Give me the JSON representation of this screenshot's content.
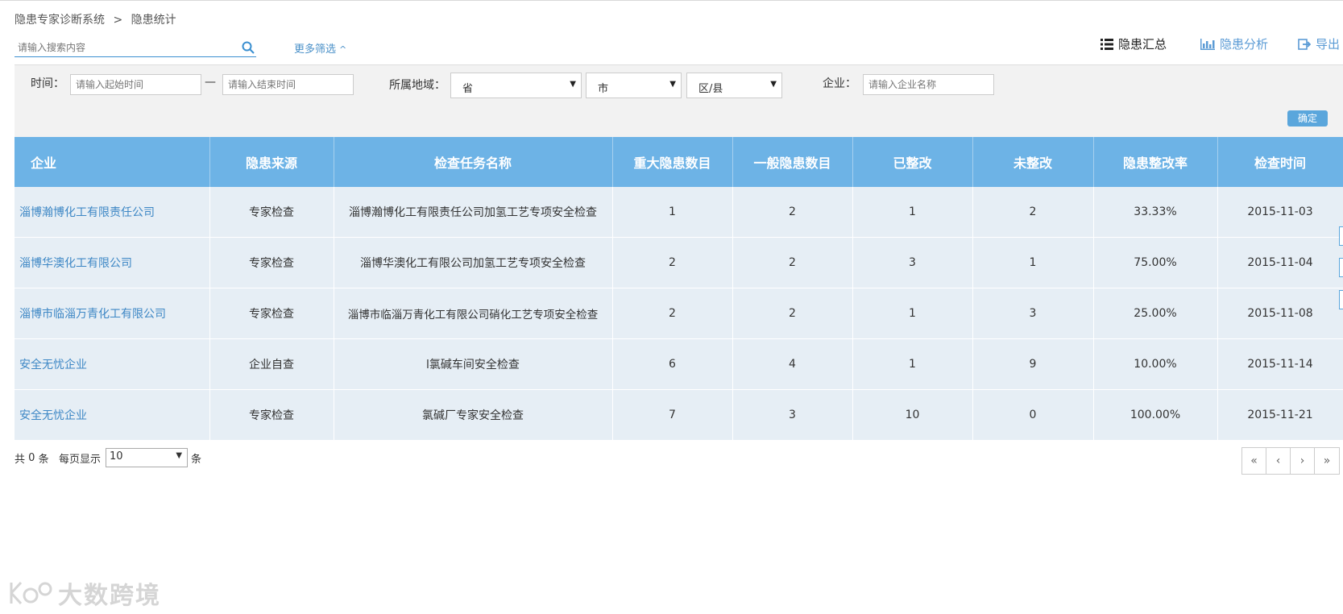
{
  "breadcrumb": [
    "隐患专家诊断系统",
    ">",
    "隐患统计"
  ],
  "search": {
    "placeholder": "请输入搜索内容",
    "icon": "search-icon"
  },
  "more_filter": {
    "label": "更多筛选",
    "icon": "chevron-up-icon"
  },
  "actions": [
    {
      "label": "隐患汇总",
      "icon": "list-icon",
      "active": true
    },
    {
      "label": "隐患分析",
      "icon": "bar-chart-icon",
      "active": false
    },
    {
      "label": "导出",
      "icon": "export-icon",
      "active": false
    }
  ],
  "filters": {
    "time_label": "时间：",
    "start_placeholder": "请输入起始时间",
    "dash": "—",
    "end_placeholder": "请输入结束时间",
    "region_label": "所属地域：",
    "province": "省",
    "city": "市",
    "district": "区/县",
    "company_label": "企业：",
    "company_placeholder": "请输入企业名称",
    "confirm": "确定"
  },
  "table": {
    "headers": [
      "企业",
      "隐患来源",
      "检查任务名称",
      "重大隐患数目",
      "一般隐患数目",
      "已整改",
      "未整改",
      "隐患整改率",
      "检查时间"
    ],
    "rows": [
      [
        "淄博瀚博化工有限责任公司",
        "专家检查",
        "淄博瀚博化工有限责任公司加氢工艺专项安全检查",
        "1",
        "2",
        "1",
        "2",
        "33.33%",
        "2015-11-03"
      ],
      [
        "淄博华澳化工有限公司",
        "专家检查",
        "淄博华澳化工有限公司加氢工艺专项安全检查",
        "2",
        "2",
        "3",
        "1",
        "75.00%",
        "2015-11-04"
      ],
      [
        "淄博市临淄万青化工有限公司",
        "专家检查",
        "淄博市临淄万青化工有限公司硝化工艺专项安全检查",
        "2",
        "2",
        "1",
        "3",
        "25.00%",
        "2015-11-08"
      ],
      [
        "安全无忧企业",
        "企业自查",
        "l氯碱车间安全检查",
        "6",
        "4",
        "1",
        "9",
        "10.00%",
        "2015-11-14"
      ],
      [
        "安全无忧企业",
        "专家检查",
        "氯碱厂专家安全检查",
        "7",
        "3",
        "10",
        "0",
        "100.00%",
        "2015-11-21"
      ]
    ]
  },
  "footer": {
    "total_prefix": "共",
    "total_count": "0",
    "total_suffix": "条",
    "per_page_label": "每页显示",
    "per_page_value": "10",
    "per_page_suffix": "条"
  },
  "pager": [
    "«",
    "‹",
    "›",
    "»"
  ],
  "watermark": {
    "text": "大数跨境"
  },
  "colors": {
    "header_bg": "#6db3e6",
    "row_bg": "#e6eef5",
    "link": "#3d87c5",
    "accent": "#5aa6dc"
  }
}
